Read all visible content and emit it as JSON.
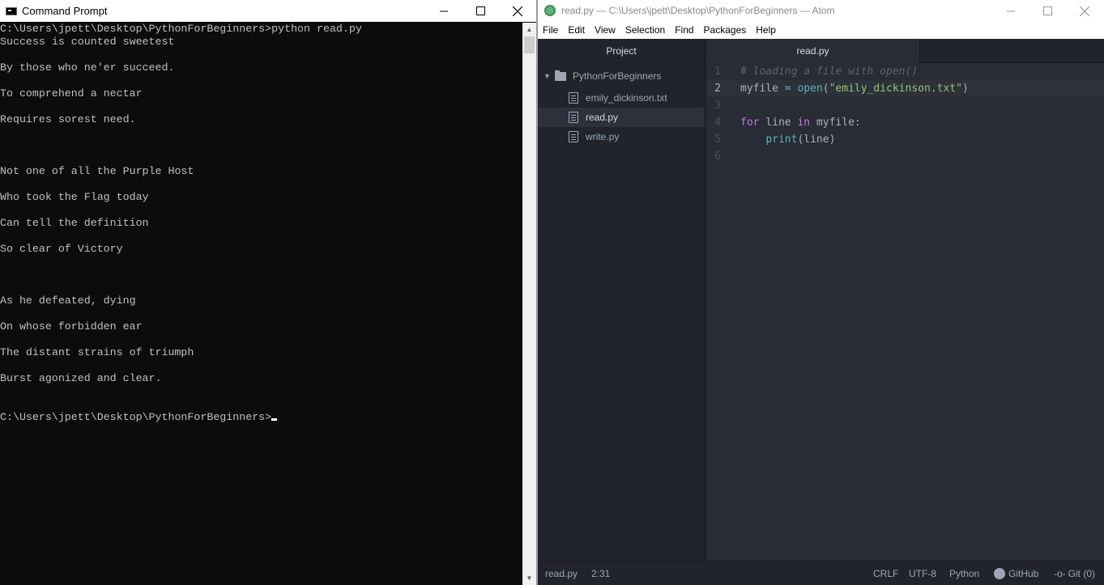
{
  "cmd": {
    "title": "Command Prompt",
    "lines": [
      "C:\\Users\\jpett\\Desktop\\PythonForBeginners>python read.py",
      "Success is counted sweetest",
      "",
      "By those who ne'er succeed.",
      "",
      "To comprehend a nectar",
      "",
      "Requires sorest need.",
      "",
      "",
      "",
      "Not one of all the Purple Host",
      "",
      "Who took the Flag today",
      "",
      "Can tell the definition",
      "",
      "So clear of Victory",
      "",
      "",
      "",
      "As he defeated, dying",
      "",
      "On whose forbidden ear",
      "",
      "The distant strains of triumph",
      "",
      "Burst agonized and clear.",
      "",
      "",
      "C:\\Users\\jpett\\Desktop\\PythonForBeginners>"
    ]
  },
  "atom": {
    "title": "read.py — C:\\Users\\jpett\\Desktop\\PythonForBeginners — Atom",
    "menu": [
      "File",
      "Edit",
      "View",
      "Selection",
      "Find",
      "Packages",
      "Help"
    ],
    "tree": {
      "header": "Project",
      "root": "PythonForBeginners",
      "files": [
        "emily_dickinson.txt",
        "read.py",
        "write.py"
      ]
    },
    "tab": "read.py",
    "code": {
      "numbers": [
        "1",
        "2",
        "3",
        "4",
        "5",
        "6"
      ],
      "l1_comment": "# loading a file with open()",
      "l2_var": "myfile",
      "l2_eq": " = ",
      "l2_fn": "open",
      "l2_open": "(",
      "l2_str": "\"emily_dickinson.txt\"",
      "l2_close": ")",
      "l4_for": "for",
      "l4_line": " line ",
      "l4_in": "in",
      "l4_rest": " myfile:",
      "l5_indent": "    ",
      "l5_fn": "print",
      "l5_rest": "(line)"
    },
    "status": {
      "file": "read.py",
      "position": "2:31",
      "line_ending": "CRLF",
      "encoding": "UTF-8",
      "grammar": "Python",
      "github": "GitHub",
      "git": "Git (0)"
    }
  }
}
